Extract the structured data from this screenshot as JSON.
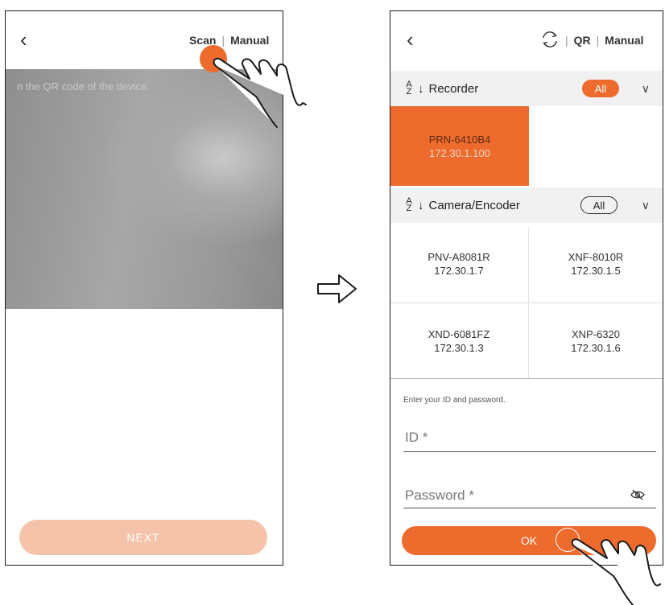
{
  "left_screen": {
    "nav": {
      "scan_label": "Scan",
      "manual_label": "Manual"
    },
    "camera_hint": "n the QR code of the device.",
    "next_label": "NEXT"
  },
  "right_screen": {
    "nav": {
      "qr_label": "QR",
      "manual_label": "Manual"
    },
    "recorder": {
      "label": "Recorder",
      "filter": "All",
      "devices": [
        {
          "model": "PRN-6410B4",
          "ip": "172.30.1.100",
          "selected": true
        }
      ]
    },
    "camera": {
      "label": "Camera/Encoder",
      "filter": "All",
      "devices": [
        {
          "model": "PNV-A8081R",
          "ip": "172.30.1.7"
        },
        {
          "model": "XNF-8010R",
          "ip": "172.30.1.5"
        },
        {
          "model": "XND-6081FZ",
          "ip": "172.30.1.3"
        },
        {
          "model": "XNP-6320",
          "ip": "172.30.1.6"
        }
      ]
    },
    "credentials_prompt": "Enter your ID and password.",
    "id_label": "ID *",
    "password_label": "Password *",
    "ok_label": "OK"
  },
  "colors": {
    "accent": "#ee6b2e",
    "accent_light": "#f4c3a9",
    "header_bg": "#f1f1f1"
  }
}
